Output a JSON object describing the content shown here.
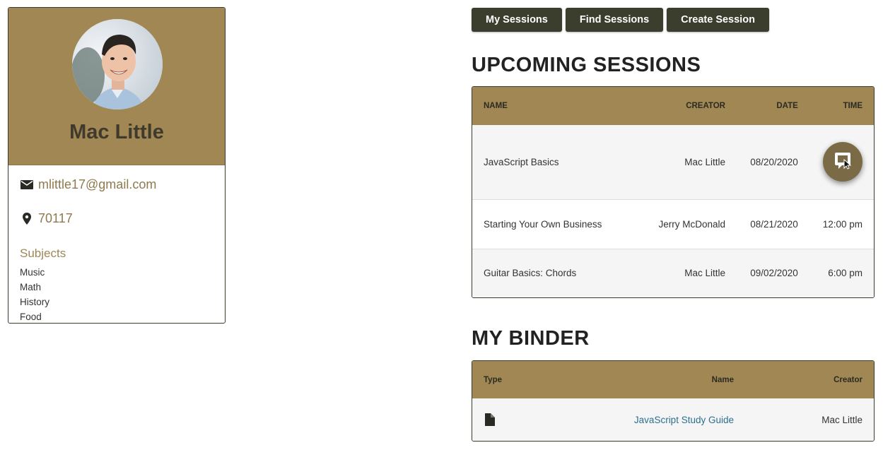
{
  "profile": {
    "name": "Mac Little",
    "email": "mlittle17@gmail.com",
    "zip": "70117",
    "subjects_title": "Subjects",
    "subjects": [
      "Music",
      "Math",
      "History",
      "Food"
    ]
  },
  "nav": {
    "my_sessions": "My Sessions",
    "find_sessions": "Find Sessions",
    "create_session": "Create Session"
  },
  "upcoming": {
    "title": "UPCOMING SESSIONS",
    "headers": {
      "name": "NAME",
      "creator": "CREATOR",
      "date": "DATE",
      "time": "TIME"
    },
    "rows": [
      {
        "name": "JavaScript Basics",
        "creator": "Mac Little",
        "date": "08/20/2020",
        "time": ""
      },
      {
        "name": "Starting Your Own Business",
        "creator": "Jerry McDonald",
        "date": "08/21/2020",
        "time": "12:00 pm"
      },
      {
        "name": "Guitar Basics: Chords",
        "creator": "Mac Little",
        "date": "09/02/2020",
        "time": "6:00 pm"
      }
    ]
  },
  "binder": {
    "title": "MY BINDER",
    "headers": {
      "type": "Type",
      "name": "Name",
      "creator": "Creator"
    },
    "rows": [
      {
        "type_icon": "document-icon",
        "name": "JavaScript Study Guide",
        "creator": "Mac Little"
      }
    ]
  },
  "colors": {
    "accent": "#a08754",
    "button": "#3b3e2c",
    "link": "#2c6f8e"
  }
}
